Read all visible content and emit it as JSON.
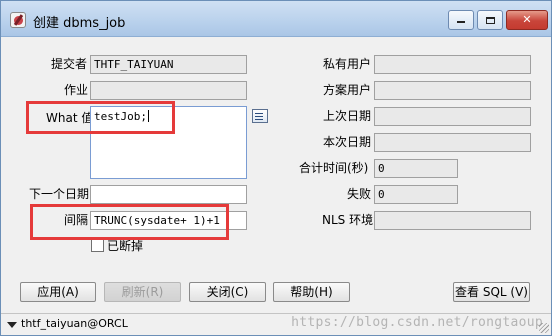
{
  "window": {
    "title": "创建 dbms_job",
    "minimize_icon": "minimize-icon",
    "maximize_icon": "maximize-icon",
    "close_glyph": "✕"
  },
  "form": {
    "submitter_label": "提交者",
    "submitter_value": "THTF_TAIYUAN",
    "job_label": "作业",
    "job_value": "",
    "what_label": "What 值",
    "what_value": "testJob;",
    "next_date_label": "下一个日期",
    "next_date_value": "",
    "interval_label": "间隔",
    "interval_value": "TRUNC(sysdate+ 1)+1",
    "broken_label": "已断掉",
    "private_user_label": "私有用户",
    "private_user_value": "",
    "schema_user_label": "方案用户",
    "schema_user_value": "",
    "last_date_label": "上次日期",
    "last_date_value": "",
    "this_date_label": "本次日期",
    "this_date_value": "",
    "total_time_label": "合计时间(秒)",
    "total_time_value": "0",
    "failures_label": "失败",
    "failures_value": "0",
    "nls_label": "NLS 环境",
    "nls_value": ""
  },
  "buttons": {
    "apply": "应用(A)",
    "refresh": "刷新(R)",
    "close": "关闭(C)",
    "help": "帮助(H)",
    "view_sql": "查看 SQL (V)"
  },
  "status": {
    "connection": "thtf_taiyuan@ORCL",
    "watermark": "https://blog.csdn.net/rongtaoup"
  },
  "highlight_color": "#e53a3a"
}
